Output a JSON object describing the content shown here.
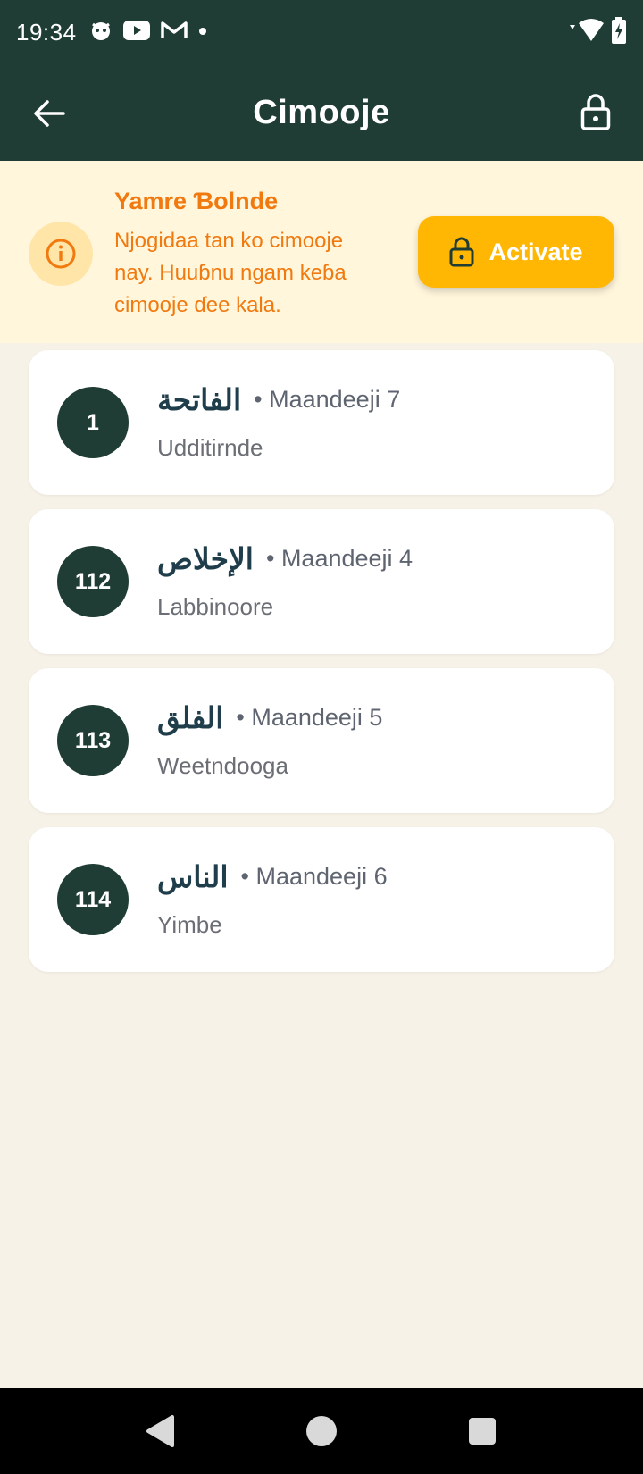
{
  "status_bar": {
    "time": "19:34"
  },
  "app_bar": {
    "title": "Cimooje"
  },
  "banner": {
    "title": "Yamre Ɓolnde",
    "text": "Njogidaa tan ko cimooje nay. Huuɓnu ngam keɓa cimooje ɗee kala.",
    "button_label": "Activate"
  },
  "items": [
    {
      "number": "1",
      "arabic": "الفاتحة",
      "verses": "• Maandeeji 7",
      "name": "Udditirnde"
    },
    {
      "number": "112",
      "arabic": "الإخلاص",
      "verses": "• Maandeeji 4",
      "name": "Labbinoore"
    },
    {
      "number": "113",
      "arabic": "الفلق",
      "verses": "• Maandeeji 5",
      "name": "Weetndooga"
    },
    {
      "number": "114",
      "arabic": "الناس",
      "verses": "• Maandeeji 6",
      "name": "Yimbe"
    }
  ],
  "colors": {
    "primary": "#1f3d35",
    "accent": "#ffb703",
    "warning_text": "#f07a10",
    "background": "#f7f2e8"
  }
}
